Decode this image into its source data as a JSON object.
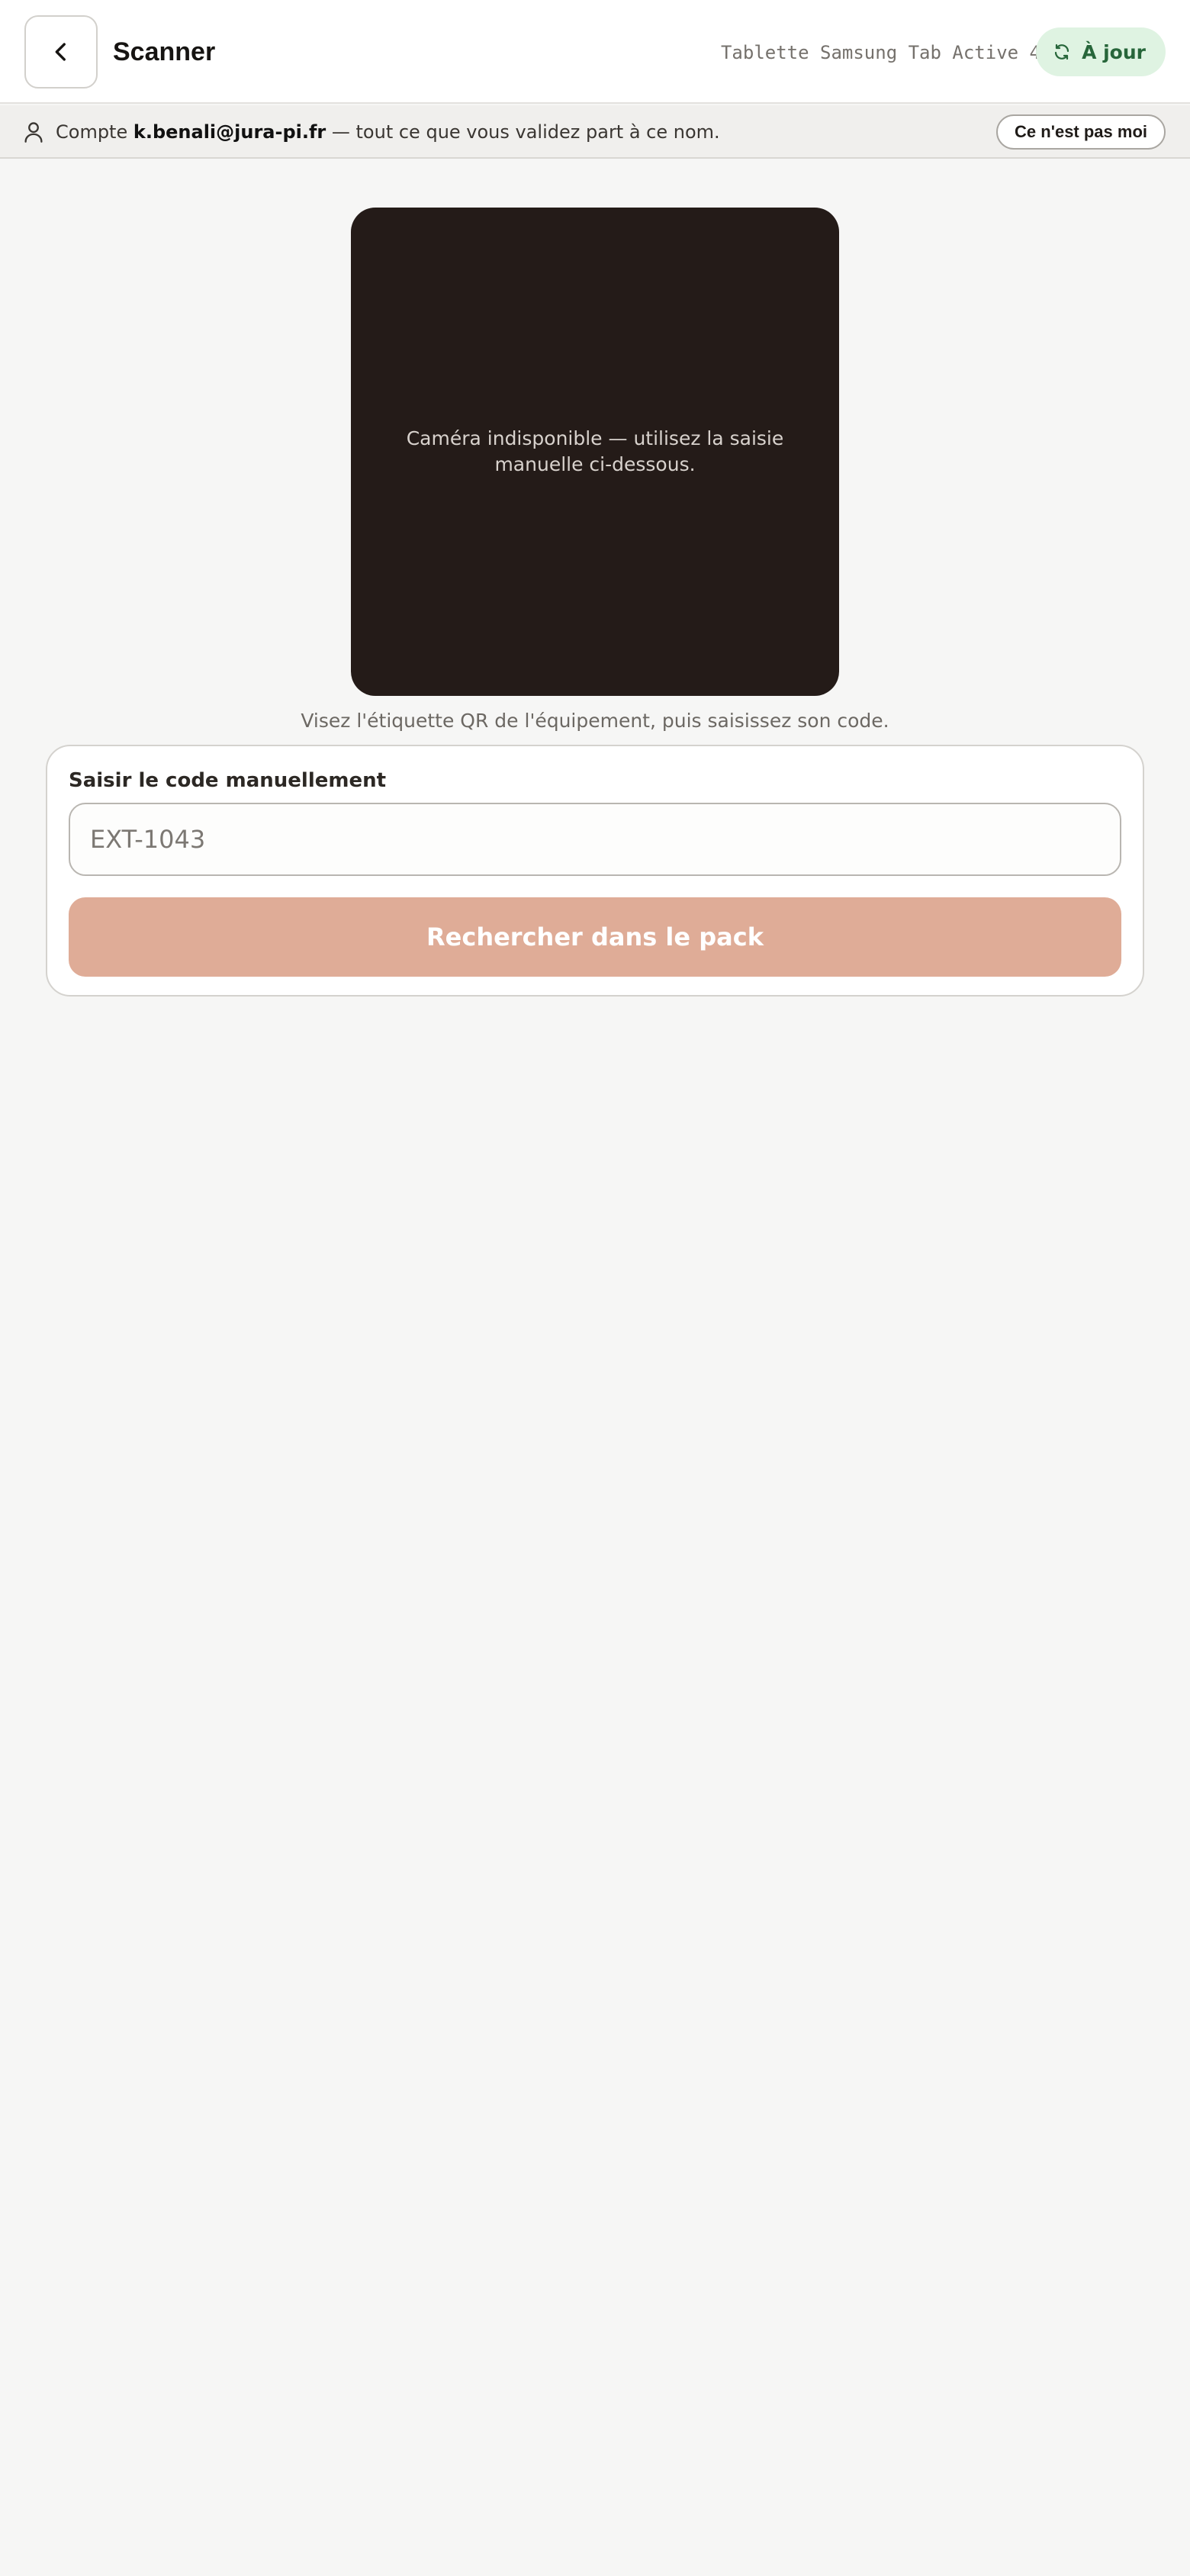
{
  "header": {
    "back_icon": "chevron-left-icon",
    "title": "Scanner",
    "device": "Tablette Samsung Tab Active 4",
    "sync_icon": "sync-icon",
    "sync_status": "À jour",
    "sync_color": "#27663a"
  },
  "account_bar": {
    "icon": "user-icon",
    "prefix": "Compte",
    "email": "k.benali@jura-pi.fr",
    "suffix": "— tout ce que vous validez part à ce nom.",
    "not_me_label": "Ce n'est pas moi"
  },
  "camera": {
    "message": "Caméra indisponible — utilisez la saisie manuelle ci-dessous."
  },
  "hint": "Visez l'étiquette QR de l'équipement, puis saisissez son code.",
  "manual_entry": {
    "label": "Saisir le code manuellement",
    "placeholder": "EXT-1043",
    "value": "",
    "search_label": "Rechercher dans le pack",
    "button_color": "#dfac97"
  }
}
